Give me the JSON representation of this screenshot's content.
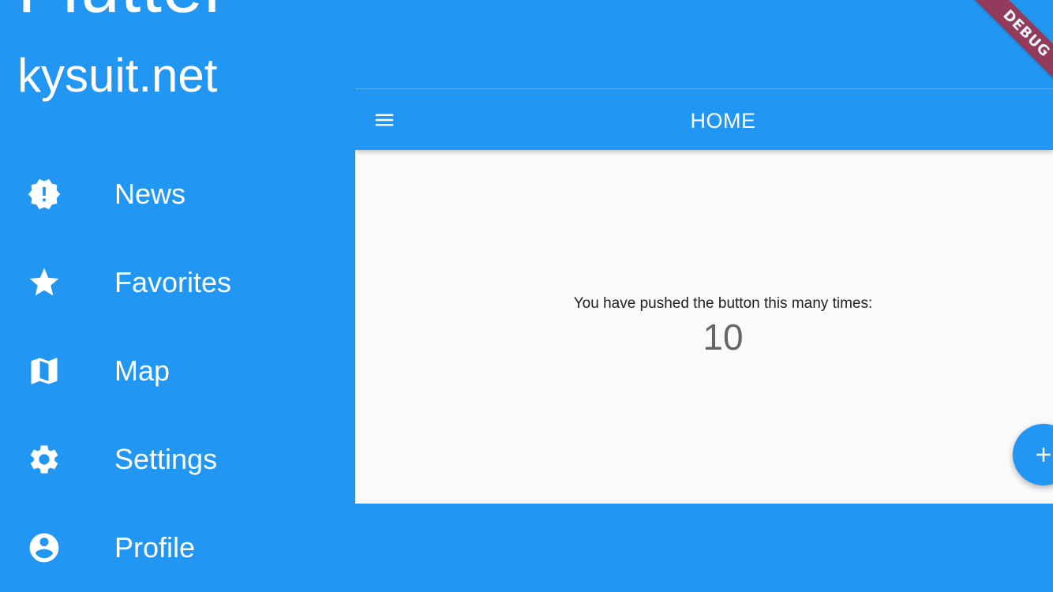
{
  "drawer": {
    "header_big": "Flutter",
    "header_sub": "kysuit.net",
    "items": [
      {
        "label": "News",
        "icon": "new-releases-icon"
      },
      {
        "label": "Favorites",
        "icon": "star-icon"
      },
      {
        "label": "Map",
        "icon": "map-icon"
      },
      {
        "label": "Settings",
        "icon": "settings-icon"
      },
      {
        "label": "Profile",
        "icon": "account-circle-icon"
      }
    ]
  },
  "app": {
    "title": "HOME",
    "menu_icon": "hamburger-menu-icon",
    "counter_caption": "You have pushed the button this many times:",
    "counter_value": "10",
    "fab_icon": "plus-icon"
  },
  "debug_banner": "DEBUG",
  "colors": {
    "primary": "#2196f3",
    "background": "#fafafa",
    "banner": "#a1324b"
  }
}
